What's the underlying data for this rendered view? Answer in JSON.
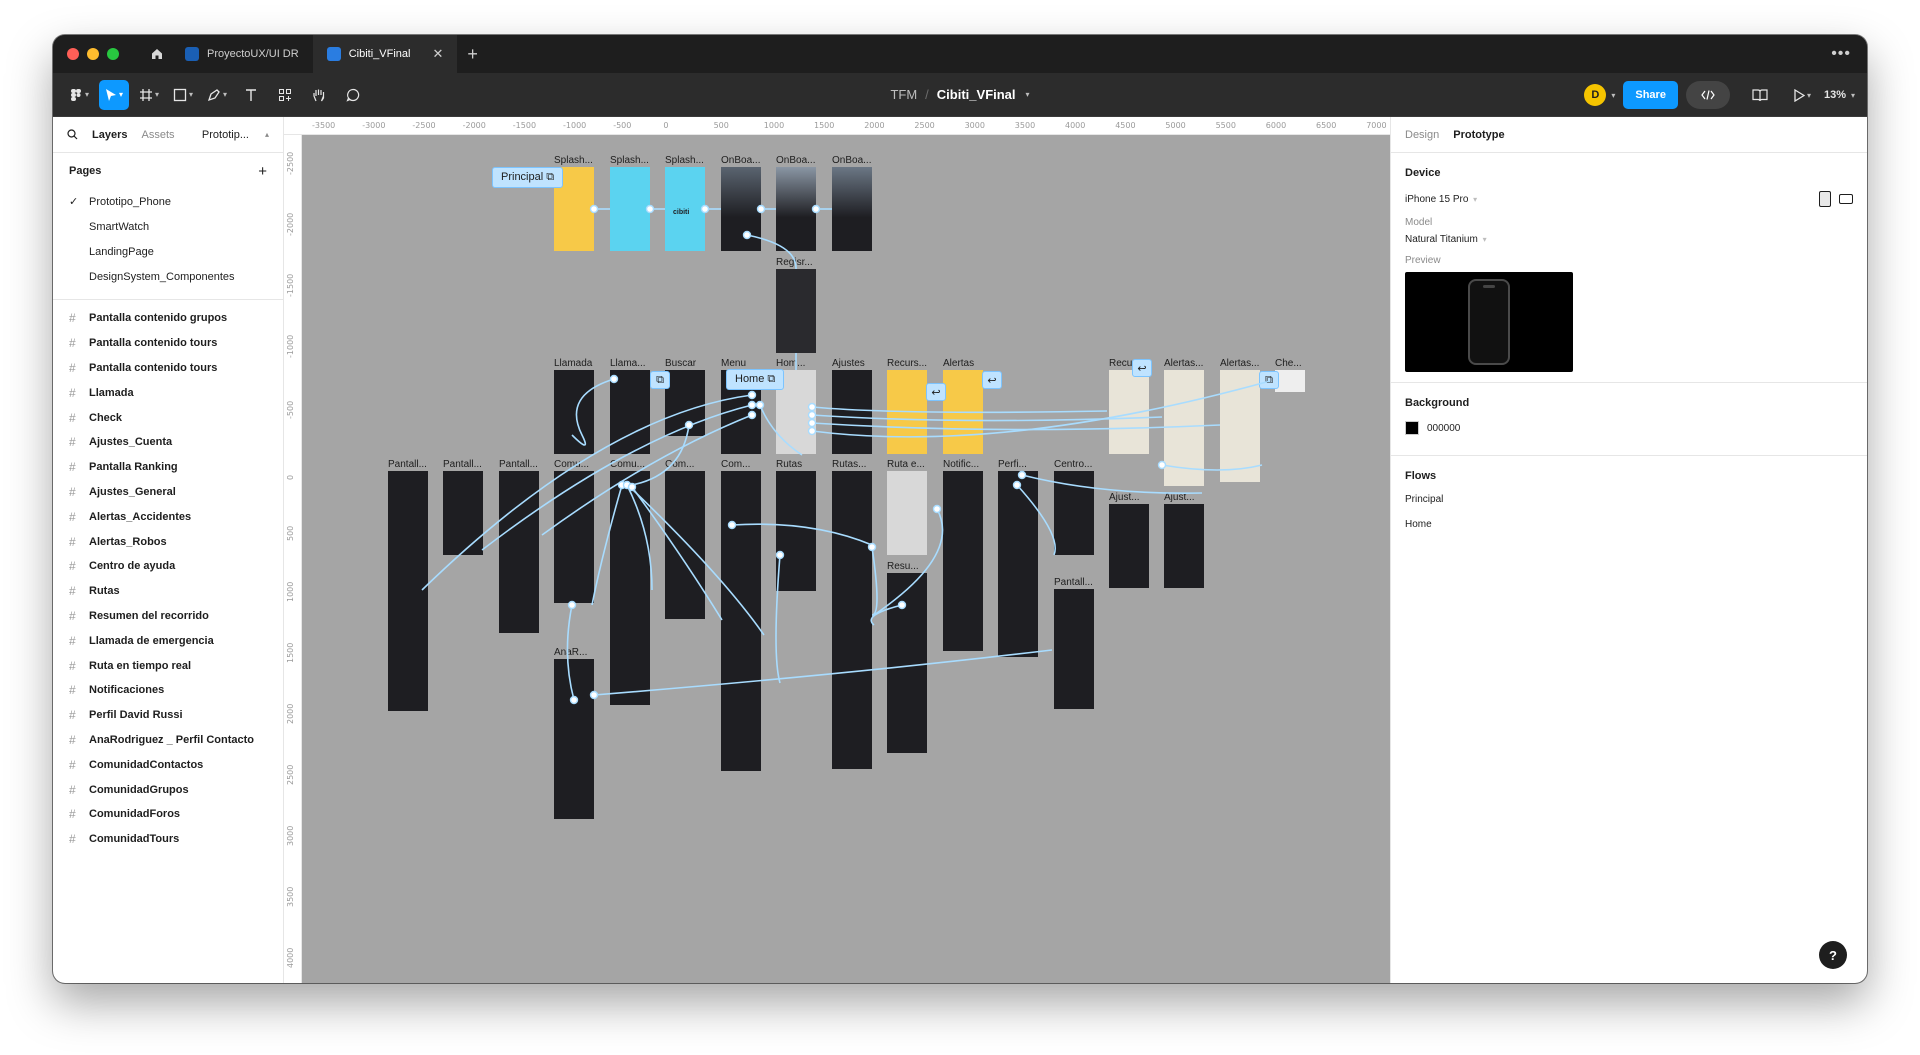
{
  "window": {
    "tabs": [
      {
        "label": "ProyectoUX/UI DR",
        "active": false
      },
      {
        "label": "Cibiti_VFinal",
        "active": true
      }
    ]
  },
  "toolbar": {
    "project": "TFM",
    "file_name": "Cibiti_VFinal",
    "avatar_initial": "D",
    "share_label": "Share",
    "zoom": "13%"
  },
  "left_panel": {
    "tabs": [
      "Layers",
      "Assets",
      "Prototip..."
    ],
    "pages_title": "Pages",
    "pages": [
      {
        "label": "Prototipo_Phone",
        "checked": true
      },
      {
        "label": "SmartWatch",
        "checked": false
      },
      {
        "label": "LandingPage",
        "checked": false
      },
      {
        "label": "DesignSystem_Componentes",
        "checked": false
      }
    ],
    "layers": [
      "Pantalla contenido grupos",
      "Pantalla contenido tours",
      "Pantalla contenido tours",
      "Llamada",
      "Check",
      "Ajustes_Cuenta",
      "Pantalla Ranking",
      "Ajustes_General",
      "Alertas_Accidentes",
      "Alertas_Robos",
      "Centro de ayuda",
      "Rutas",
      "Resumen del recorrido",
      "Llamada de emergencia",
      "Ruta en tiempo real",
      "Notificaciones",
      "Perfil David Russi",
      "AnaRodriguez _ Perfil Contacto",
      "ComunidadContactos",
      "ComunidadGrupos",
      "ComunidadForos",
      "ComunidadTours"
    ]
  },
  "rulers": {
    "horizontal": [
      "-3500",
      "-3000",
      "-2500",
      "-2000",
      "-1500",
      "-1000",
      "-500",
      "0",
      "500",
      "1000",
      "1500",
      "2000",
      "2500",
      "3000",
      "3500",
      "4000",
      "4500",
      "5000",
      "5500",
      "6000",
      "6500",
      "7000"
    ],
    "vertical": [
      "-2500",
      "-2000",
      "-1500",
      "-1000",
      "-500",
      "0",
      "500",
      "1000",
      "1500",
      "2000",
      "2500",
      "3000",
      "3500",
      "4000"
    ]
  },
  "canvas": {
    "flow_tags": {
      "principal": "Principal",
      "home": "Home"
    },
    "labels": {
      "splash1": "Splash...",
      "splash2": "Splash...",
      "splash3": "Splash...",
      "onboa1": "OnBoa...",
      "onboa2": "OnBoa...",
      "onboa3": "OnBoa...",
      "registro": "Regisr...",
      "llamada": "Llamada",
      "llama2": "Llama...",
      "buscar": "Buscar",
      "menu": "Menu",
      "home": "Hom...",
      "ajustes": "Ajustes",
      "recurs": "Recurs...",
      "alertas": "Alertas",
      "recur2": "Recur...",
      "alertas2": "Alertas...",
      "alertas3": "Alertas...",
      "che": "Che...",
      "pantall1": "Pantall...",
      "pantall2": "Pantall...",
      "pantall3": "Pantall...",
      "comu1": "Comu...",
      "comu2": "Comu...",
      "comu3": "Com...",
      "comu4": "Com...",
      "rutas": "Rutas",
      "rutas2": "Rutas...",
      "rutae": "Ruta e...",
      "notific": "Notific...",
      "perfil": "Perfi...",
      "centro": "Centro...",
      "ajustes2": "Ajust...",
      "ajustes3": "Ajust...",
      "resum": "Resu...",
      "pantall4": "Pantall...",
      "ana": "AnaR..."
    },
    "splash_text": "cibiti"
  },
  "right_panel": {
    "tabs": [
      "Design",
      "Prototype"
    ],
    "device_title": "Device",
    "device_value": "iPhone 15 Pro",
    "model_label": "Model",
    "model_value": "Natural Titanium",
    "preview_label": "Preview",
    "background_title": "Background",
    "background_value": "000000",
    "flows_title": "Flows",
    "flows": [
      "Principal",
      "Home"
    ],
    "help": "?"
  },
  "colors": {
    "accent": "#0d99ff",
    "canvas": "#a5a5a5",
    "splash_yellow": "#f7c948",
    "splash_cyan": "#5bd3f0",
    "frame_dark": "#1e1e22",
    "wire": "#a8dcff"
  }
}
